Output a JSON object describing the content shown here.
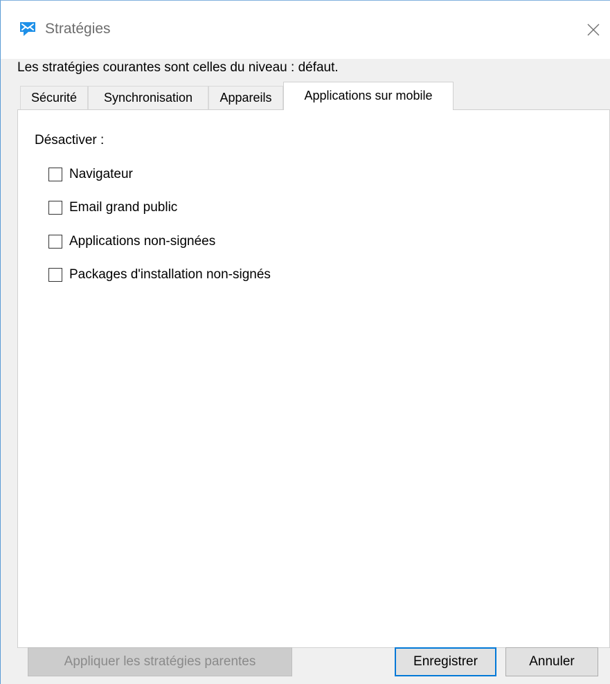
{
  "window": {
    "title": "Stratégies",
    "close_label": "×",
    "app_icon": "chat-bubble-icon",
    "accent_color": "#0078d7",
    "icon_color": "#1e90e8"
  },
  "info": {
    "text": "Les stratégies courantes sont celles du niveau : défaut."
  },
  "tabs": [
    {
      "label": "Sécurité",
      "active": false
    },
    {
      "label": "Synchronisation",
      "active": false
    },
    {
      "label": "Appareils",
      "active": false
    },
    {
      "label": "Applications sur mobile",
      "active": true
    }
  ],
  "panel": {
    "group_label": "Désactiver :",
    "options": [
      {
        "label": "Navigateur",
        "checked": false
      },
      {
        "label": "Email grand public",
        "checked": false
      },
      {
        "label": "Applications non-signées",
        "checked": false
      },
      {
        "label": "Packages d'installation non-signés",
        "checked": false
      }
    ]
  },
  "buttons": {
    "apply_parent": "Appliquer les stratégies parentes",
    "apply_parent_enabled": false,
    "save": "Enregistrer",
    "cancel": "Annuler"
  }
}
